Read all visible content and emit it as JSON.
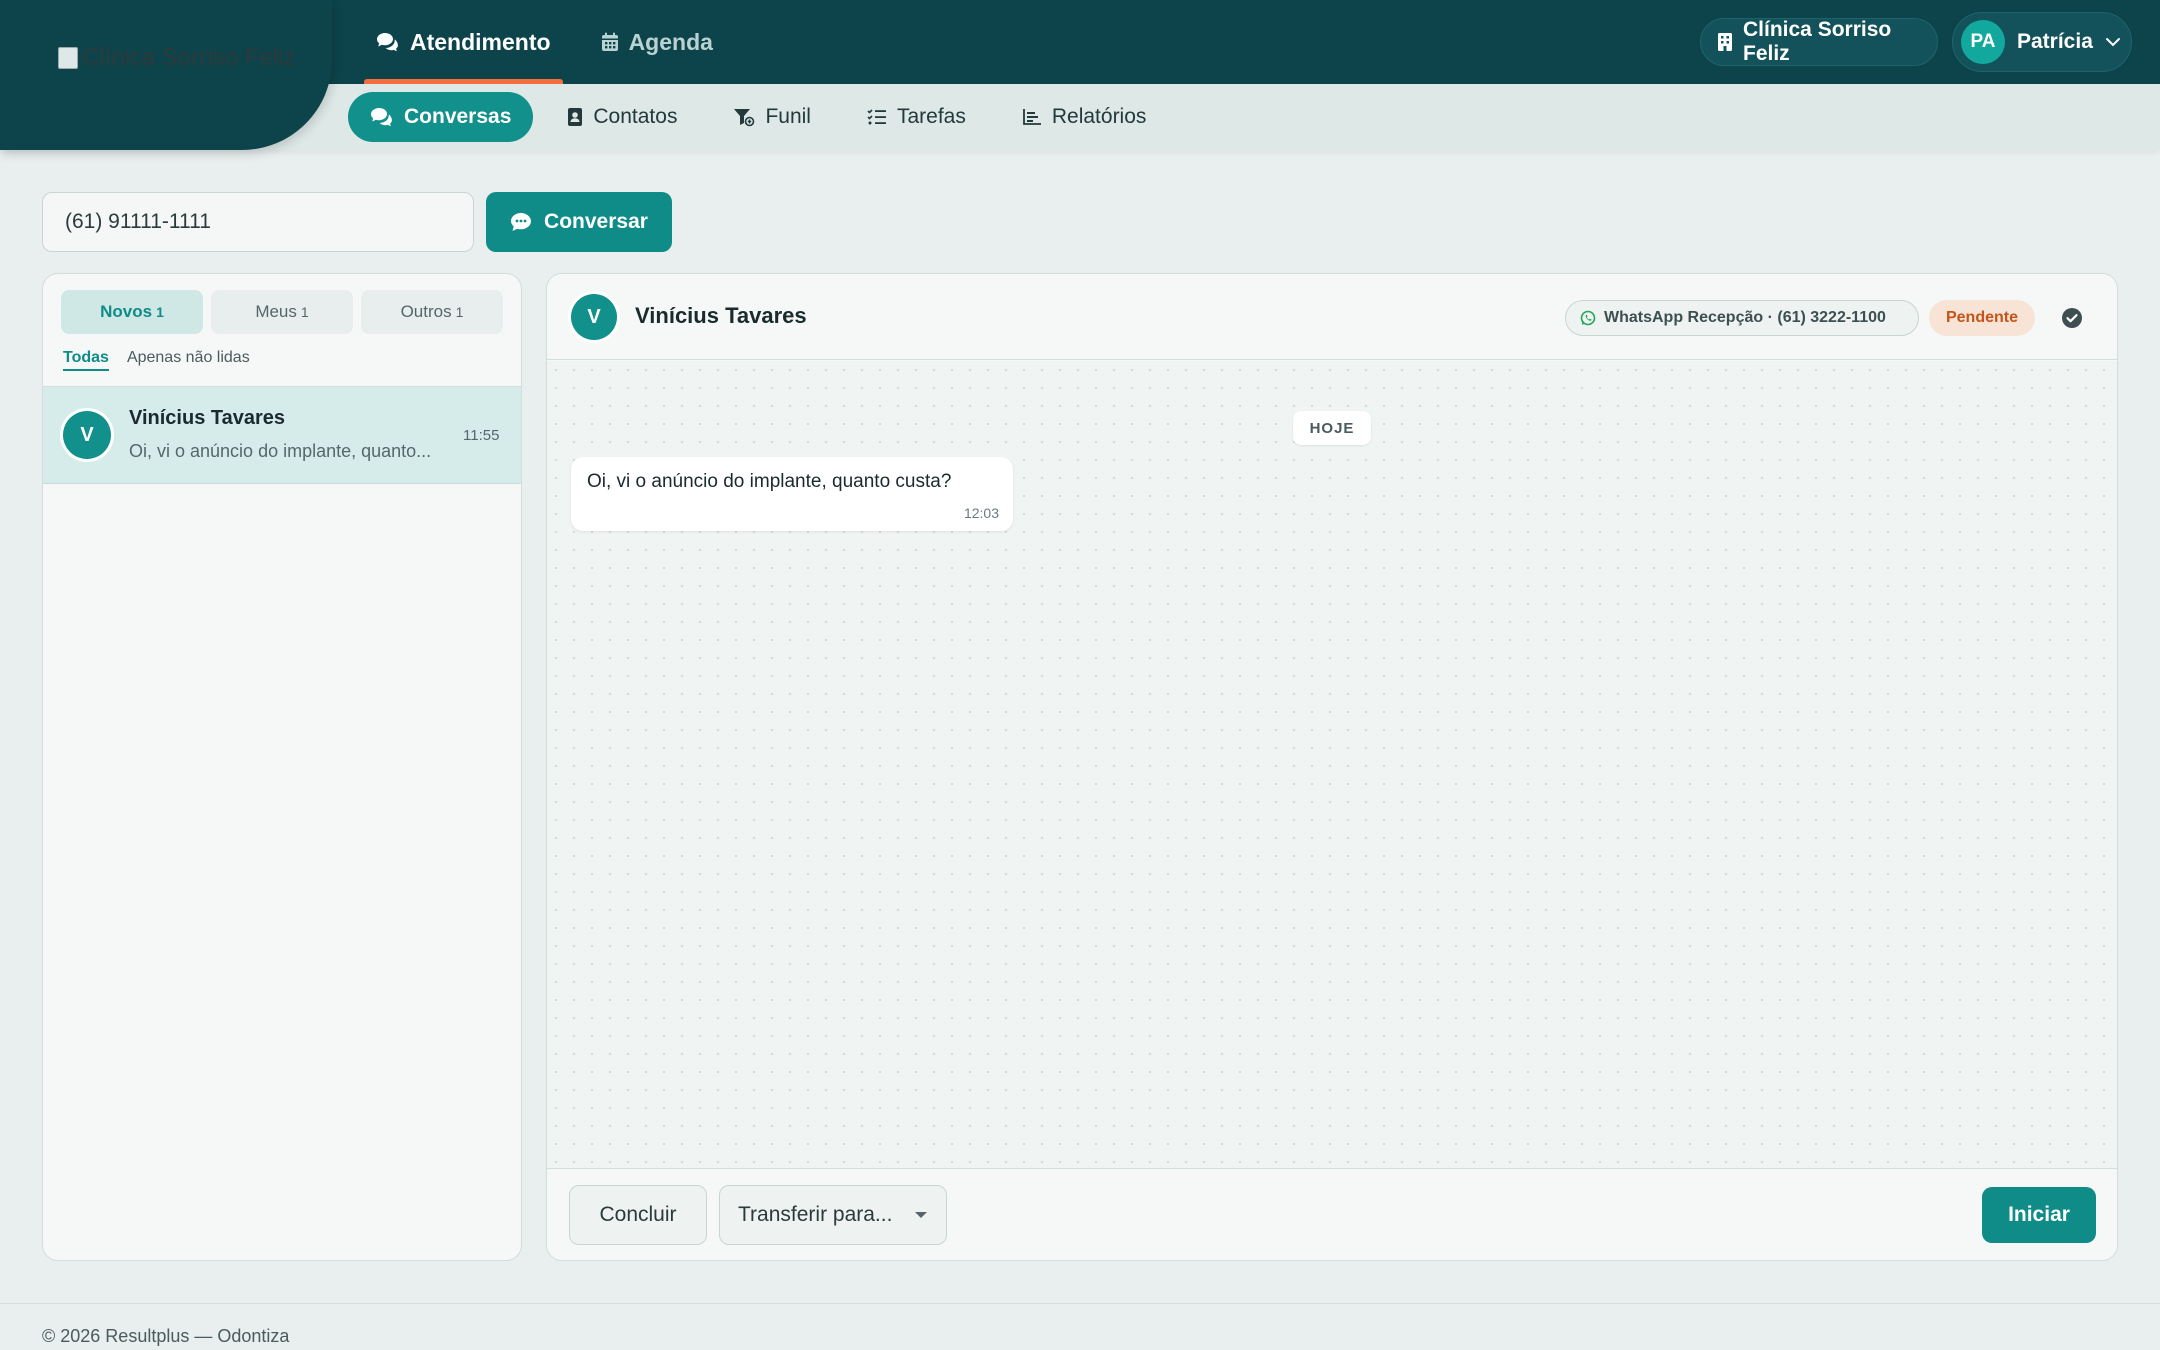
{
  "brand": {
    "logo_alt": "Clínica Sorriso Feliz"
  },
  "top_nav": [
    {
      "label": "Atendimento",
      "icon": "comments-icon",
      "active": true
    },
    {
      "label": "Agenda",
      "icon": "calendar-icon",
      "active": false
    }
  ],
  "clinic_switcher": {
    "label": "Clínica Sorriso Feliz",
    "icon": "building-icon"
  },
  "user_menu": {
    "initials": "PA",
    "name": "Patrícia",
    "icon": "chevron-down-icon"
  },
  "sub_nav": [
    {
      "label": "Conversas",
      "icon": "comments-icon",
      "active": true
    },
    {
      "label": "Contatos",
      "icon": "address-book-icon",
      "active": false
    },
    {
      "label": "Funil",
      "icon": "funnel-icon",
      "active": false
    },
    {
      "label": "Tarefas",
      "icon": "task-list-icon",
      "active": false
    },
    {
      "label": "Relatórios",
      "icon": "bar-chart-icon",
      "active": false
    }
  ],
  "new_conversation": {
    "phone_value": "(61) 91111-1111",
    "button_label": "Conversar"
  },
  "conversation_list": {
    "segments": [
      {
        "label": "Novos",
        "count": "1",
        "active": true
      },
      {
        "label": "Meus",
        "count": "1",
        "active": false
      },
      {
        "label": "Outros",
        "count": "1",
        "active": false
      }
    ],
    "filters": [
      {
        "label": "Todas",
        "active": true
      },
      {
        "label": "Apenas não lidas",
        "active": false
      }
    ],
    "items": [
      {
        "initial": "V",
        "name": "Vinícius Tavares",
        "preview": "Oi, vi o anúncio do implante, quanto...",
        "time": "11:55"
      }
    ]
  },
  "chat": {
    "contact_initial": "V",
    "contact_name": "Vinícius Tavares",
    "channel": "WhatsApp Recepção · (61) 3222-1100",
    "status": "Pendente",
    "day_label": "HOJE",
    "messages": [
      {
        "text": "Oi, vi o anúncio do implante, quanto custa?",
        "time": "12:03",
        "direction": "incoming"
      }
    ],
    "footer": {
      "conclude_label": "Concluir",
      "transfer_label": "Transferir para...",
      "start_label": "Iniciar"
    }
  },
  "footer": {
    "text": "© 2026 Resultplus — Odontiza"
  },
  "colors": {
    "header_bg": "#0d434a",
    "accent": "#0f8b88",
    "active_tab_underline": "#f36d3d",
    "pending_text": "#c4541a",
    "pending_bg": "#f7e4d6",
    "whatsapp_green": "#25a35a"
  }
}
